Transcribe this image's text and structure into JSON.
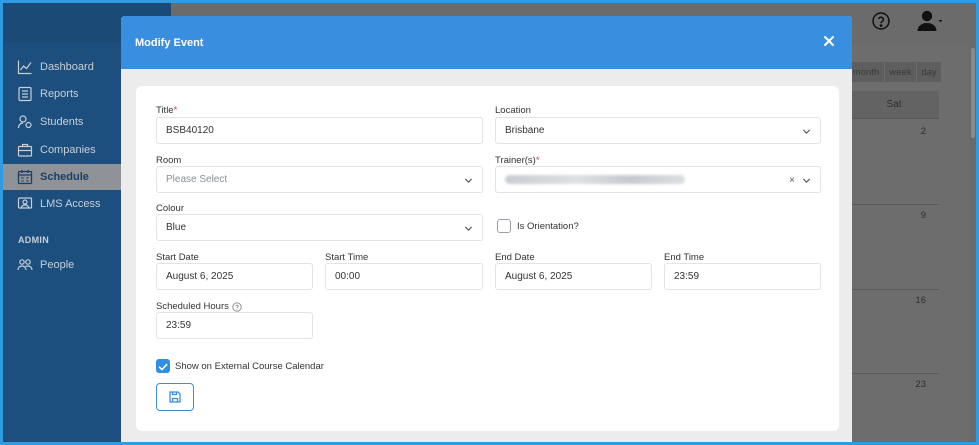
{
  "sidebar": {
    "items": [
      {
        "label": "Dashboard",
        "icon": "chart-line-icon"
      },
      {
        "label": "Reports",
        "icon": "report-icon"
      },
      {
        "label": "Students",
        "icon": "students-icon"
      },
      {
        "label": "Companies",
        "icon": "briefcase-icon"
      },
      {
        "label": "Schedule",
        "icon": "calendar-icon",
        "active": true
      },
      {
        "label": "LMS Access",
        "icon": "lms-icon"
      }
    ],
    "admin_label": "ADMIN",
    "admin_items": [
      {
        "label": "People",
        "icon": "people-icon"
      }
    ]
  },
  "calendar": {
    "views": [
      "month",
      "week",
      "day"
    ],
    "column_header": "Sat",
    "day_numbers": [
      "2",
      "9",
      "16",
      "23"
    ]
  },
  "modal": {
    "title": "Modify Event",
    "fields": {
      "title": {
        "label": "Title",
        "value": "BSB40120",
        "required": true
      },
      "location": {
        "label": "Location",
        "value": "Brisbane"
      },
      "room": {
        "label": "Room",
        "placeholder": "Please Select"
      },
      "trainers": {
        "label": "Trainer(s)",
        "required": true,
        "clear_symbol": "×"
      },
      "colour": {
        "label": "Colour",
        "value": "Blue"
      },
      "is_orientation": {
        "label": "Is Orientation?",
        "checked": false
      },
      "start_date": {
        "label": "Start Date",
        "value": "August 6, 2025"
      },
      "start_time": {
        "label": "Start Time",
        "value": "00:00"
      },
      "end_date": {
        "label": "End Date",
        "value": "August 6, 2025"
      },
      "end_time": {
        "label": "End Time",
        "value": "23:59"
      },
      "scheduled_hours": {
        "label": "Scheduled Hours",
        "value": "23:59"
      },
      "show_external": {
        "label": "Show on External Course Calendar",
        "checked": true
      }
    }
  },
  "colors": {
    "accent": "#3a8ee0",
    "sidebar": "#1d4f7e",
    "required": "#e03b3b"
  }
}
